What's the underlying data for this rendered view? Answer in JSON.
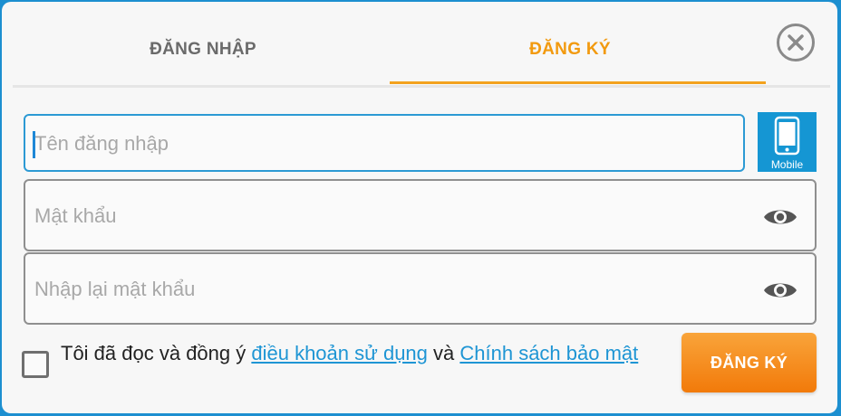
{
  "tabs": {
    "login_label": "ĐĂNG NHẬP",
    "register_label": "ĐĂNG KÝ",
    "active": "register"
  },
  "icons": {
    "close": "close-icon",
    "mobile": "mobile-phone-icon",
    "eye": "eye-icon"
  },
  "form": {
    "username": {
      "placeholder": "Tên đăng nhập",
      "value": ""
    },
    "password": {
      "placeholder": "Mật khẩu",
      "value": ""
    },
    "confirm_password": {
      "placeholder": "Nhập lại mật khẩu",
      "value": ""
    },
    "mobile_label": "Mobile"
  },
  "terms": {
    "text_before": "Tôi đã đọc và đồng ý ",
    "terms_link": "điều khoản sử dụng",
    "text_middle": " và ",
    "privacy_link": "Chính sách bảo mật",
    "checked": false
  },
  "submit": {
    "label": "ĐĂNG KÝ"
  },
  "colors": {
    "accent": "#f29a0f",
    "link": "#1e95d4",
    "focus": "#2c9ad4",
    "background": "#1c8fd0"
  }
}
